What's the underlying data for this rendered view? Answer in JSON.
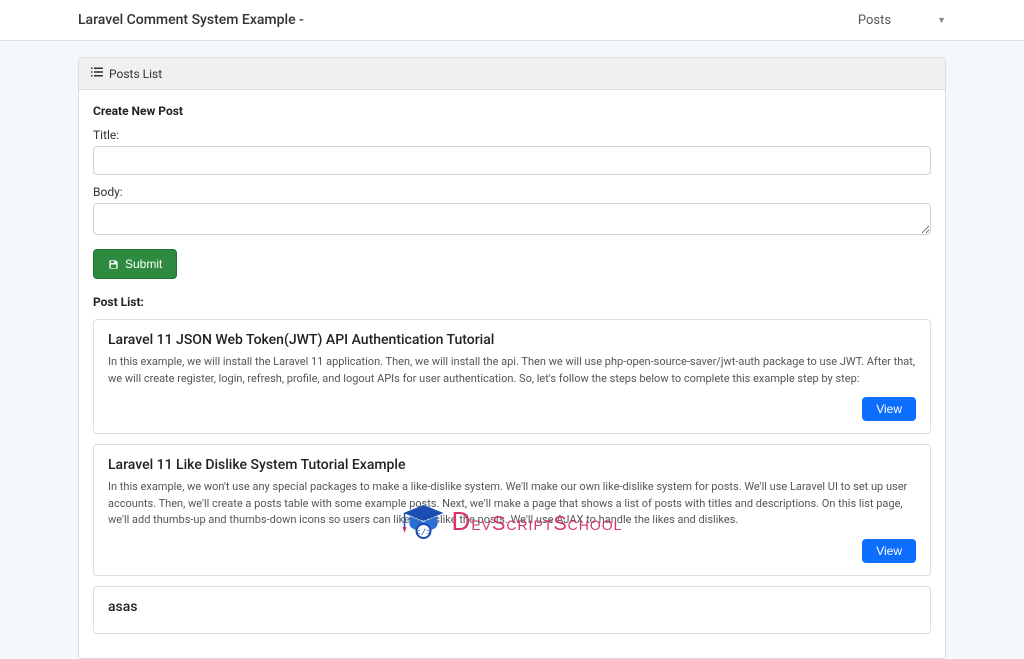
{
  "navbar": {
    "brand": "Laravel Comment System Example -",
    "menu_label": "Posts"
  },
  "card": {
    "header_label": "Posts List"
  },
  "form": {
    "heading": "Create New Post",
    "title_label": "Title:",
    "title_value": "",
    "body_label": "Body:",
    "body_value": "",
    "submit_label": "Submit"
  },
  "post_list": {
    "heading": "Post List:",
    "view_label": "View",
    "posts": [
      {
        "title": "Laravel 11 JSON Web Token(JWT) API Authentication Tutorial",
        "body": "In this example, we will install the Laravel 11 application. Then, we will install the api. Then we will use php-open-source-saver/jwt-auth package to use JWT. After that, we will create register, login, refresh, profile, and logout APIs for user authentication. So, let's follow the steps below to complete this example step by step:"
      },
      {
        "title": "Laravel 11 Like Dislike System Tutorial Example",
        "body": "In this example, we won't use any special packages to make a like-dislike system. We'll make our own like-dislike system for posts. We'll use Laravel UI to set up user accounts. Then, we'll create a posts table with some example posts. Next, we'll make a page that shows a list of posts with titles and descriptions. On this list page, we'll add thumbs-up and thumbs-down icons so users can like or dislike the posts. We'll use AJAX to handle the likes and dislikes."
      },
      {
        "title": "asas",
        "body": ""
      }
    ]
  },
  "watermark": {
    "text_d": "D",
    "text_rest": "evScriptSchool"
  }
}
